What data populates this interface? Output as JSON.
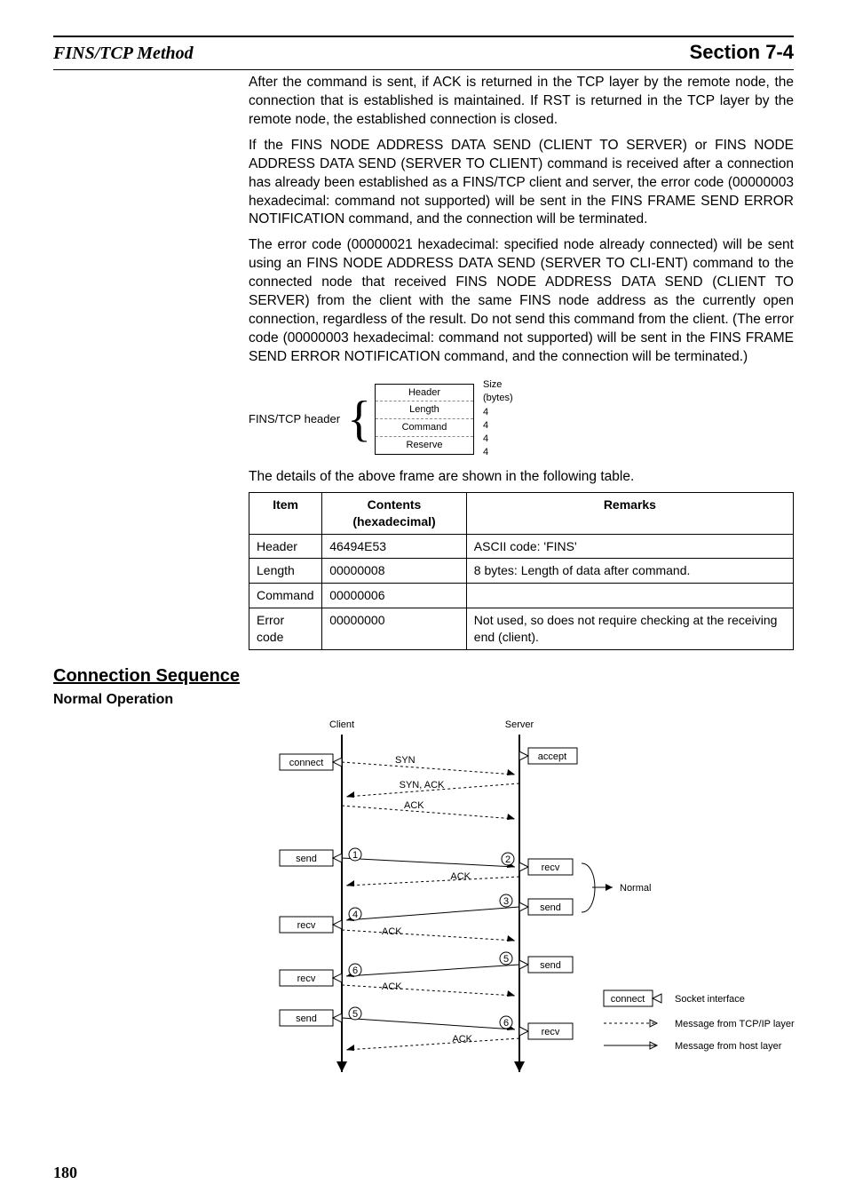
{
  "header": {
    "left": "FINS/TCP Method",
    "right": "Section 7-4"
  },
  "paragraphs": {
    "p1": "After the command is sent, if ACK is returned in the TCP layer by the remote node, the connection that is established is maintained. If RST is returned in the TCP layer by the remote node, the established connection is closed.",
    "p2": "If the FINS NODE ADDRESS DATA SEND (CLIENT TO SERVER) or FINS NODE ADDRESS DATA SEND (SERVER TO CLIENT) command is received after a connection has already been established as a FINS/TCP client and server, the error code (00000003 hexadecimal: command not supported) will be sent in the FINS FRAME SEND ERROR NOTIFICATION command, and the connection will be terminated.",
    "p3": "The error code (00000021 hexadecimal: specified node already connected) will be sent using an FINS NODE ADDRESS DATA SEND (SERVER TO CLI-ENT) command to the connected node that received FINS NODE ADDRESS DATA SEND (CLIENT TO SERVER) from the client with the same FINS node address as the currently open connection, regardless of the result. Do not send this command from the client. (The error code (00000003 hexadecimal: command not supported) will be sent in the FINS FRAME SEND ERROR NOTIFICATION command, and the connection will be terminated.)"
  },
  "frame_diagram": {
    "group_label": "FINS/TCP header",
    "size_header1": "Size",
    "size_header2": "(bytes)",
    "rows": [
      {
        "name": "Header",
        "size": "4"
      },
      {
        "name": "Length",
        "size": "4"
      },
      {
        "name": "Command",
        "size": "4"
      },
      {
        "name": "Reserve",
        "size": "4"
      }
    ]
  },
  "table_caption": "The details of the above frame are shown in the following table.",
  "table": {
    "headers": [
      "Item",
      "Contents (hexadecimal)",
      "Remarks"
    ],
    "rows": [
      {
        "item": "Header",
        "contents": "46494E53",
        "remarks": "ASCII code: 'FINS'"
      },
      {
        "item": "Length",
        "contents": "00000008",
        "remarks": "8 bytes: Length of data after command."
      },
      {
        "item": "Command",
        "contents": "00000006",
        "remarks": ""
      },
      {
        "item": "Error code",
        "contents": "00000000",
        "remarks": "Not used, so does not require checking at the receiving end (client)."
      }
    ]
  },
  "section_heading": "Connection Sequence",
  "subsection_heading": "Normal Operation",
  "sequence": {
    "roles": {
      "client": "Client",
      "server": "Server"
    },
    "client_calls": [
      "connect",
      "send",
      "recv",
      "recv",
      "send"
    ],
    "server_calls": [
      "accept",
      "recv",
      "send",
      "send",
      "recv"
    ],
    "arrow_labels": {
      "syn": "SYN",
      "synack": "SYN, ACK",
      "ack": "ACK"
    },
    "numbers": [
      "1",
      "2",
      "3",
      "4",
      "5",
      "6"
    ],
    "normal_label": "Normal",
    "legend": {
      "connect_label": "connect",
      "socket_interface": "Socket interface",
      "tcp_layer": "Message from TCP/IP layer",
      "host_layer": "Message from host layer"
    }
  },
  "page_number": "180"
}
